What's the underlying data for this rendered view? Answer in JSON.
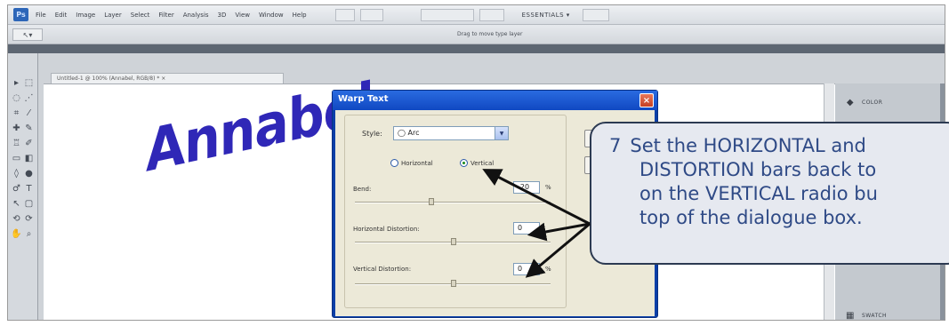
{
  "app": {
    "logo_text": "Ps"
  },
  "menu": {
    "items": [
      "File",
      "Edit",
      "Image",
      "Layer",
      "Select",
      "Filter",
      "Analysis",
      "3D",
      "View",
      "Window",
      "Help"
    ],
    "workspace_label": "ESSENTIALS ▾"
  },
  "options_bar": {
    "tool_preset": "↖▾",
    "hint": "Drag to move type layer"
  },
  "document": {
    "tab_title": "Untitled-1 @ 100% (Annabel, RGB/8) * ×",
    "warped_text": "Annabel"
  },
  "panels": {
    "items": [
      {
        "icon": "color-icon",
        "label": "COLOR"
      },
      {
        "icon": "swatches-icon",
        "label": "SWATCH"
      }
    ]
  },
  "dialog": {
    "title": "Warp Text",
    "close_glyph": "×",
    "style_label": "Style:",
    "style_value": "◯ Arc",
    "radio_horizontal": "Horizontal",
    "radio_vertical": "Vertical",
    "orientation_selected": "Vertical",
    "bend_label": "Bend:",
    "bend_value": "-20",
    "horizontal_distortion_label": "Horizontal Distortion:",
    "horizontal_distortion_value": "0",
    "vertical_distortion_label": "Vertical Distortion:",
    "vertical_distortion_value": "0",
    "percent": "%"
  },
  "callout": {
    "number": "7",
    "lines": [
      "Set the HORIZONTAL and",
      "DISTORTION bars back to",
      "on the VERTICAL radio bu",
      "top of the dialogue box."
    ]
  },
  "colors": {
    "accent_text": "#2f27b7",
    "callout_text": "#2f4a86",
    "callout_bg": "#e6e9f0",
    "dialog_title_bg": "#1048c2"
  }
}
